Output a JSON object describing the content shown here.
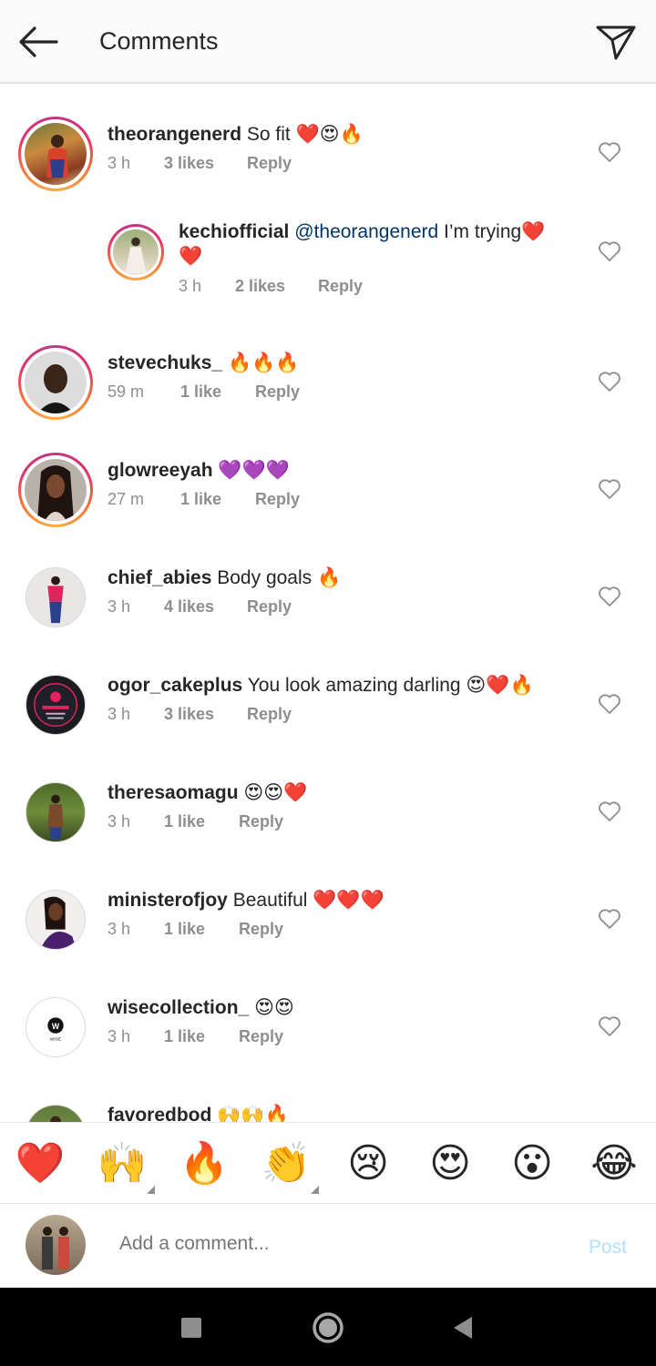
{
  "header": {
    "title": "Comments",
    "back_icon": "back-arrow-icon",
    "send_icon": "direct-send-icon"
  },
  "comments": [
    {
      "username": "theorangenerd",
      "mention": "",
      "text": "So fit ❤️😍🔥",
      "time": "3 h",
      "likes": "3 likes",
      "reply": "Reply",
      "story_ring": true
    },
    {
      "username": "kechiofficial",
      "mention": "@theorangenerd",
      "text": "I’m trying❤️",
      "text2": "❤️",
      "time": "3 h",
      "likes": "2 likes",
      "reply": "Reply",
      "story_ring": true,
      "is_reply": true
    },
    {
      "username": "stevechuks_",
      "mention": "",
      "text": "🔥🔥🔥",
      "time": "59 m",
      "likes": "1 like",
      "reply": "Reply",
      "story_ring": true
    },
    {
      "username": "glowreeyah",
      "mention": "",
      "text": "💜💜💜",
      "time": "27 m",
      "likes": "1 like",
      "reply": "Reply",
      "story_ring": true
    },
    {
      "username": "chief_abies",
      "mention": "",
      "text": "Body goals 🔥",
      "time": "3 h",
      "likes": "4 likes",
      "reply": "Reply",
      "story_ring": false
    },
    {
      "username": "ogor_cakeplus",
      "mention": "",
      "text": "You look amazing darling 😍❤️🔥",
      "time": "3 h",
      "likes": "3 likes",
      "reply": "Reply",
      "story_ring": false
    },
    {
      "username": "theresaomagu",
      "mention": "",
      "text": "😍😍❤️",
      "time": "3 h",
      "likes": "1 like",
      "reply": "Reply",
      "story_ring": false
    },
    {
      "username": "ministerofjoy",
      "mention": "",
      "text": "Beautiful ❤️❤️❤️",
      "time": "3 h",
      "likes": "1 like",
      "reply": "Reply",
      "story_ring": false
    },
    {
      "username": "wisecollection_",
      "mention": "",
      "text": "😍😍",
      "time": "3 h",
      "likes": "1 like",
      "reply": "Reply",
      "story_ring": false
    },
    {
      "username": "favoredbod",
      "mention": "",
      "text": "🙌🙌🔥",
      "time": "",
      "likes": "",
      "reply": "",
      "story_ring": false
    }
  ],
  "quick_emojis": [
    "❤️",
    "🙌",
    "🔥",
    "👏",
    "😢",
    "😍",
    "😮",
    "😂"
  ],
  "composer": {
    "placeholder": "Add a comment...",
    "post_label": "Post"
  },
  "wise_logo_text": "WISE",
  "colors": {
    "link": "#003569",
    "meta": "#8e8e8e",
    "post_disabled": "#b2dffc"
  }
}
